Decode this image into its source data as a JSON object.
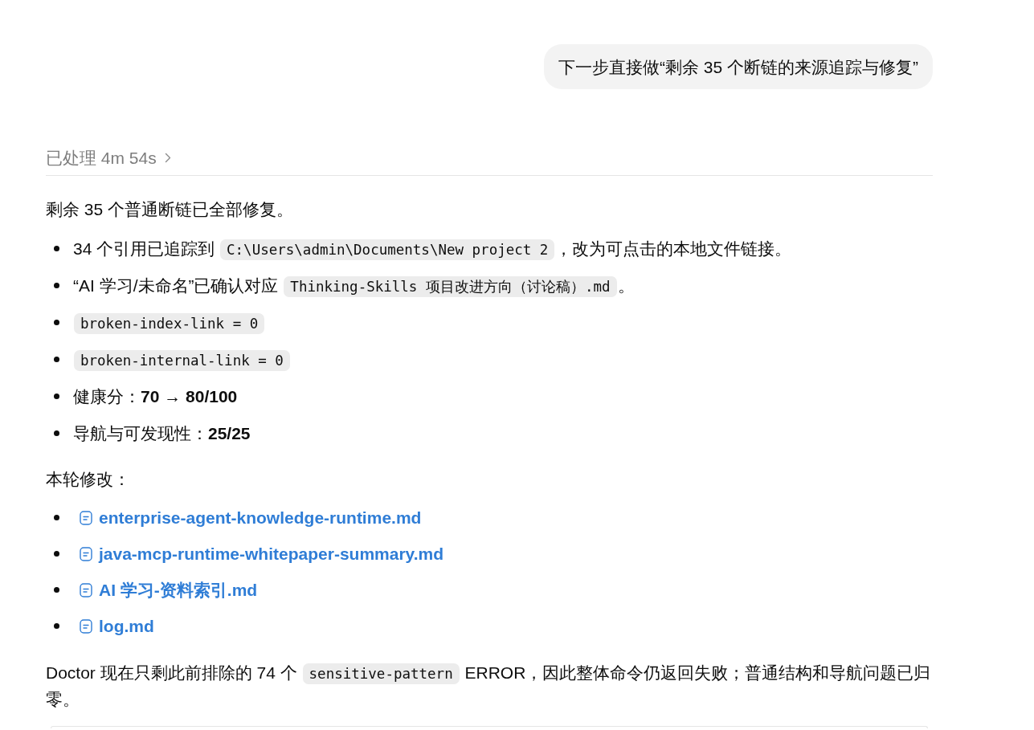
{
  "user_message": {
    "text": "下一步直接做“剩余 35 个断链的来源追踪与修复”"
  },
  "processing": {
    "label": "已处理 4m 54s"
  },
  "reply": {
    "summary": "剩余 35 个普通断链已全部修复。",
    "points": [
      {
        "parts": [
          {
            "kind": "text",
            "text": "34 个引用已追踪到 "
          },
          {
            "kind": "code",
            "text": "C:\\Users\\admin\\Documents\\New project 2"
          },
          {
            "kind": "text",
            "text": "，改为可点击的本地文件链接。"
          }
        ]
      },
      {
        "parts": [
          {
            "kind": "text",
            "text": "“AI 学习/未命名”已确认对应 "
          },
          {
            "kind": "code",
            "text": "Thinking-Skills 项目改进方向（讨论稿）.md"
          },
          {
            "kind": "text",
            "text": "。"
          }
        ]
      },
      {
        "parts": [
          {
            "kind": "code",
            "text": "broken-index-link = 0"
          }
        ]
      },
      {
        "parts": [
          {
            "kind": "code",
            "text": "broken-internal-link = 0"
          }
        ]
      },
      {
        "parts": [
          {
            "kind": "text",
            "text": "健康分：**70 → 80/100**"
          }
        ]
      },
      {
        "parts": [
          {
            "kind": "text",
            "text": "导航与可发现性：**25/25**"
          }
        ]
      }
    ],
    "changes_heading": "本轮修改：",
    "changed_files": [
      {
        "name": "enterprise-agent-knowledge-runtime.md"
      },
      {
        "name": "java-mcp-runtime-whitepaper-summary.md"
      },
      {
        "name": "AI 学习-资料索引.md"
      },
      {
        "name": "log.md"
      }
    ],
    "conclusion": [
      {
        "kind": "text",
        "text": "Doctor 现在只剩此前排除的 74 个 "
      },
      {
        "kind": "code",
        "text": "sensitive-pattern"
      },
      {
        "kind": "text",
        "text": " ERROR，因此整体命令仍返回失败；普通结构和导航问题已归零。"
      }
    ]
  }
}
